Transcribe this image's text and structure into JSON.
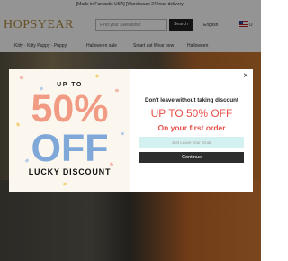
{
  "topbar": {
    "text": "[Made in Fantastic USA] [Warehouse 24 hour delivery]"
  },
  "header": {
    "logo": "HOPSYEAR",
    "search_placeholder": "Find your Sweatshirt",
    "search_button": "Search",
    "language": "English",
    "currency": "U"
  },
  "nav": {
    "items": [
      "Kitty · Kitty Puppy · Puppy",
      "Halloween sale",
      "Smart cat Wear bow",
      "Halloween"
    ]
  },
  "popup": {
    "promo": {
      "up_to": "UP TO",
      "percent": "50%",
      "off": "OFF",
      "label": "LUCKY DISCOUNT"
    },
    "close_label": "×",
    "headline": "Don't leave without taking discount",
    "offer": "UP TO 50% OFF",
    "subline": "On your first order",
    "email_placeholder": "Just Leave Your Email",
    "email_value": "",
    "continue_label": "Continue"
  },
  "colors": {
    "accent_red": "#e8504a",
    "promo_pink": "#f29b84",
    "promo_blue": "#7fa8d8",
    "email_bg": "#d3f1f0",
    "button_bg": "#2d2d2d"
  }
}
